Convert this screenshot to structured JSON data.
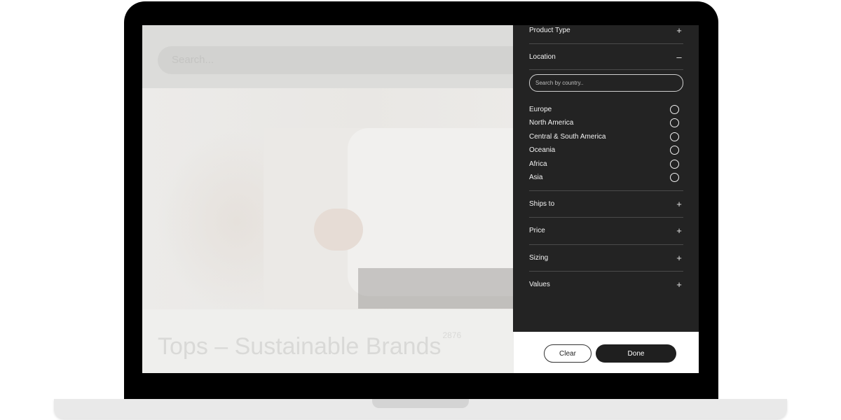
{
  "page": {
    "search_placeholder": "Search...",
    "title": "Tops – Sustainable Brands",
    "count": "2876"
  },
  "filters": {
    "product_type": {
      "label": "Product Type",
      "sign": "+"
    },
    "location": {
      "label": "Location",
      "sign": "–",
      "search_placeholder": "Search by country..",
      "options": [
        "Europe",
        "North America",
        "Central & South America",
        "Oceania",
        "Africa",
        "Asia"
      ]
    },
    "ships_to": {
      "label": "Ships to",
      "sign": "+"
    },
    "price": {
      "label": "Price",
      "sign": "+"
    },
    "sizing": {
      "label": "Sizing",
      "sign": "+"
    },
    "values": {
      "label": "Values",
      "sign": "+"
    }
  },
  "footer": {
    "clear_label": "Clear",
    "done_label": "Done"
  }
}
